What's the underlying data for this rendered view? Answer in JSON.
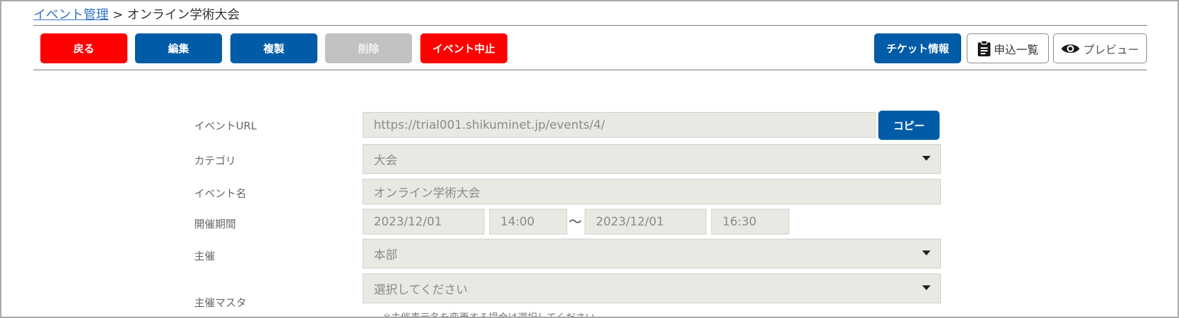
{
  "breadcrumb": {
    "parent": "イベント管理",
    "separator": " > ",
    "current": "オンライン学術大会"
  },
  "toolbar": {
    "back_label": "戻る",
    "edit_label": "編集",
    "duplicate_label": "複製",
    "delete_label": "削除",
    "cancel_event_label": "イベント中止",
    "ticket_info_label": "チケット情報",
    "application_list_label": "申込一覧",
    "preview_label": "プレビュー"
  },
  "form": {
    "url_label": "イベントURL",
    "url_value": "https://trial001.shikuminet.jp/events/4/",
    "copy_label": "コピー",
    "category_label": "カテゴリ",
    "category_value": "大会",
    "name_label": "イベント名",
    "name_value": "オンライン学術大会",
    "period_label": "開催期間",
    "start_date": "2023/12/01",
    "start_time": "14:00",
    "period_separator": "～",
    "end_date": "2023/12/01",
    "end_time": "16:30",
    "organizer_label": "主催",
    "organizer_value": "本部",
    "organizer_master_label": "主催マスタ",
    "organizer_master_value": "選択してください",
    "organizer_master_note": "※主催表示名を変更する場合は選択してください"
  },
  "colors": {
    "danger": "#ff0000",
    "primary": "#005ca6",
    "disabled": "#c2c2c2",
    "field_bg": "#e9e8e2",
    "link": "#2f6fca"
  }
}
